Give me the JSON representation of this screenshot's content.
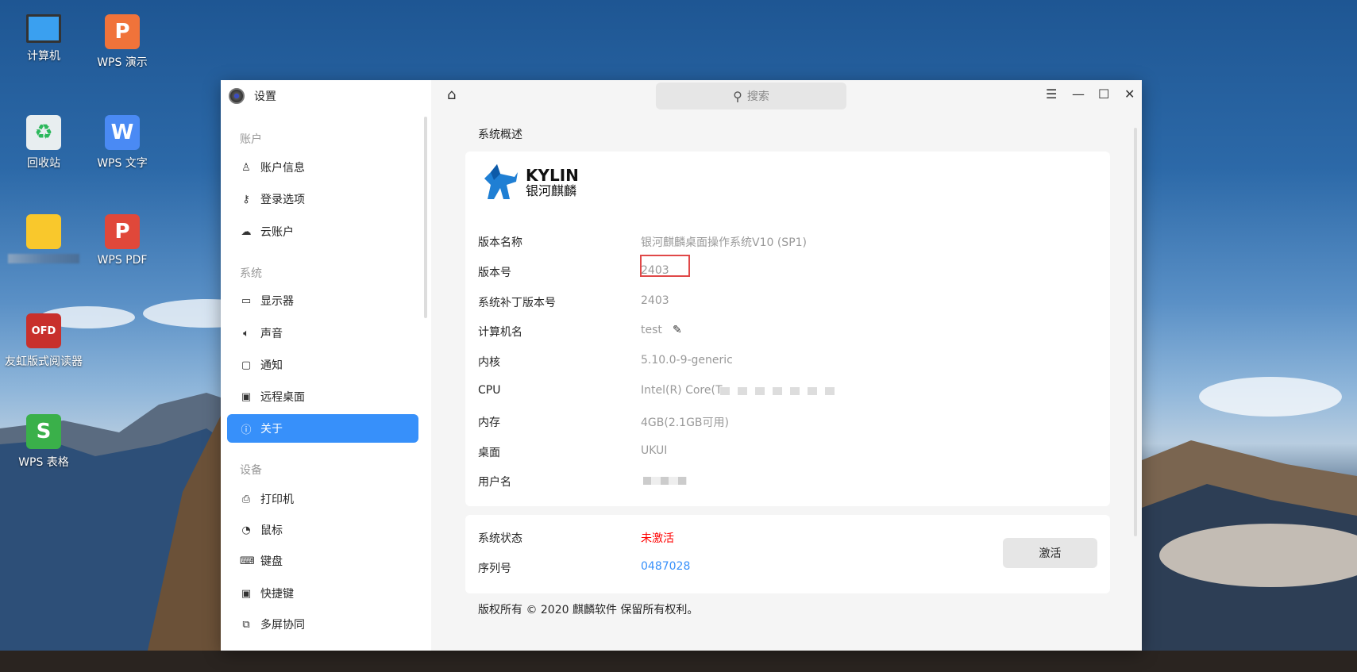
{
  "desktop": {
    "icons": [
      {
        "label": "计算机",
        "icon": "computer-icon",
        "color": "#3aa0f0"
      },
      {
        "label": "WPS 演示",
        "icon": "wps-presentation-icon",
        "color": "#f0733a",
        "glyph": "P"
      },
      {
        "label": "回收站",
        "icon": "trash-icon",
        "color": "#e8eef0",
        "glyph": "♻"
      },
      {
        "label": "WPS 文字",
        "icon": "wps-writer-icon",
        "color": "#4a8af4",
        "glyph": "W"
      },
      {
        "label": "",
        "icon": "home-folder-icon",
        "color": "#f9c82c"
      },
      {
        "label": "WPS PDF",
        "icon": "wps-pdf-icon",
        "color": "#e0483a",
        "glyph": "P"
      },
      {
        "label": "友虹版式阅读器",
        "icon": "ofd-reader-icon",
        "color": "#c8302c",
        "glyph": "OFD"
      },
      {
        "label": "WPS 表格",
        "icon": "wps-spreadsheet-icon",
        "color": "#3ab04a",
        "glyph": "S"
      }
    ]
  },
  "window": {
    "title": "设置",
    "search_placeholder": "搜索"
  },
  "sidebar": {
    "groups": [
      "账户",
      "系统",
      "设备"
    ],
    "items": [
      {
        "label": "账户信息",
        "icon": "user-icon",
        "glyph": "♙"
      },
      {
        "label": "登录选项",
        "icon": "key-icon",
        "glyph": "⚷"
      },
      {
        "label": "云账户",
        "icon": "cloud-icon",
        "glyph": "☁"
      },
      {
        "label": "显示器",
        "icon": "monitor-icon",
        "glyph": "▭"
      },
      {
        "label": "声音",
        "icon": "speaker-icon",
        "glyph": "🔈︎"
      },
      {
        "label": "通知",
        "icon": "notification-icon",
        "glyph": "▢"
      },
      {
        "label": "远程桌面",
        "icon": "remote-desktop-icon",
        "glyph": "▣"
      },
      {
        "label": "关于",
        "icon": "info-icon",
        "glyph": "ⓘ"
      },
      {
        "label": "打印机",
        "icon": "printer-icon",
        "glyph": "⎙"
      },
      {
        "label": "鼠标",
        "icon": "mouse-icon",
        "glyph": "◔"
      },
      {
        "label": "键盘",
        "icon": "keyboard-icon",
        "glyph": "⌨"
      },
      {
        "label": "快捷键",
        "icon": "shortcut-icon",
        "glyph": "▣"
      },
      {
        "label": "多屏协同",
        "icon": "multiscreen-icon",
        "glyph": "⧉"
      }
    ]
  },
  "main": {
    "section_title": "系统概述",
    "logo": {
      "en": "KYLIN",
      "zh": "银河麒麟"
    },
    "info": [
      {
        "key": "版本名称",
        "value": "银河麒麟桌面操作系统V10 (SP1)"
      },
      {
        "key": "版本号",
        "value": "2403"
      },
      {
        "key": "系统补丁版本号",
        "value": "2403"
      },
      {
        "key": "计算机名",
        "value": "test"
      },
      {
        "key": "内核",
        "value": "5.10.0-9-generic"
      },
      {
        "key": "CPU",
        "value": "Intel(R) Core(T"
      },
      {
        "key": "内存",
        "value": "4GB(2.1GB可用)"
      },
      {
        "key": "桌面",
        "value": "UKUI"
      },
      {
        "key": "用户名",
        "value": ""
      }
    ],
    "status": {
      "label": "系统状态",
      "value": "未激活",
      "value_color": "#ff0000"
    },
    "serial": {
      "label": "序列号",
      "value": "0487028",
      "value_color": "#3790fa"
    },
    "activate_label": "激活",
    "copyright": "版权所有 © 2020 麒麟软件 保留所有权利。"
  }
}
